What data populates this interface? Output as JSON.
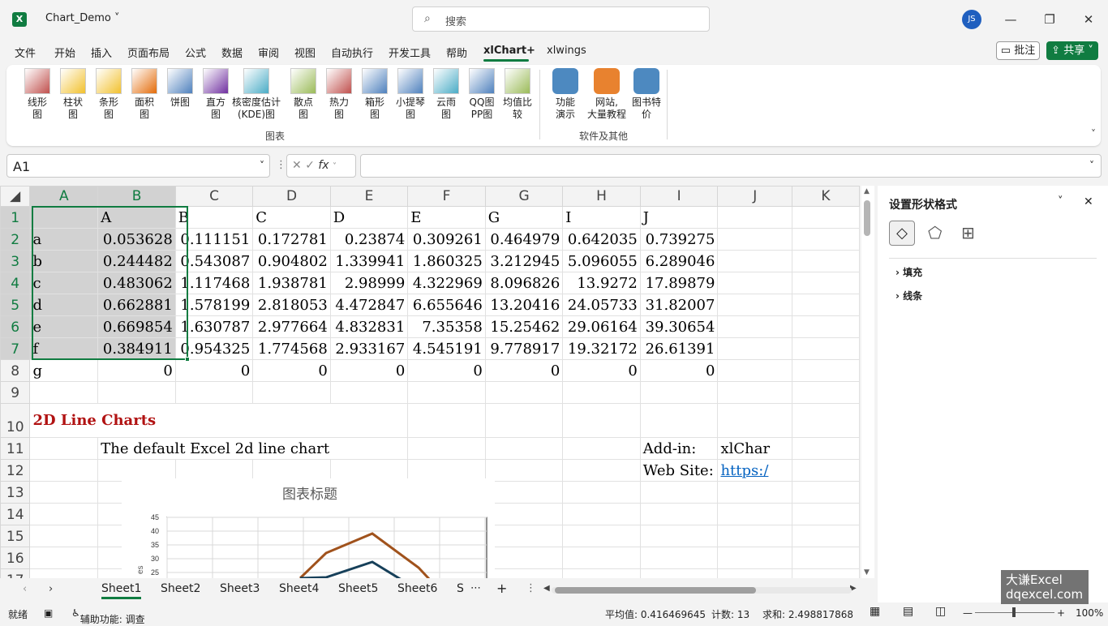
{
  "app": {
    "file_name": "Chart_Demo",
    "search_placeholder": "搜索",
    "user_initials": "JS"
  },
  "menu": {
    "tabs": [
      "文件",
      "开始",
      "插入",
      "页面布局",
      "公式",
      "数据",
      "审阅",
      "视图",
      "自动执行",
      "开发工具",
      "帮助",
      "xlChart+",
      "xlwings"
    ],
    "active_tab": "xlChart+",
    "comment": "批注",
    "share": "共享"
  },
  "ribbon": {
    "chart_buttons": [
      {
        "label": "线形\n图",
        "icon": "line-chart-icon"
      },
      {
        "label": "柱状\n图",
        "icon": "column-chart-icon"
      },
      {
        "label": "条形\n图",
        "icon": "bar-chart-icon"
      },
      {
        "label": "面积\n图",
        "icon": "area-chart-icon"
      },
      {
        "label": "饼图",
        "icon": "pie-chart-icon"
      },
      {
        "label": "直方\n图",
        "icon": "histogram-icon"
      },
      {
        "label": "核密度估计\n(KDE)图",
        "icon": "kde-chart-icon"
      },
      {
        "label": "散点\n图",
        "icon": "scatter-chart-icon"
      },
      {
        "label": "热力\n图",
        "icon": "heatmap-icon"
      },
      {
        "label": "箱形\n图",
        "icon": "box-plot-icon"
      },
      {
        "label": "小提琴\n图",
        "icon": "violin-plot-icon"
      },
      {
        "label": "云雨\n图",
        "icon": "raincloud-plot-icon"
      },
      {
        "label": "QQ图\nPP图",
        "icon": "qq-plot-icon"
      },
      {
        "label": "均值比\n较",
        "icon": "mean-compare-icon"
      }
    ],
    "other_buttons": [
      {
        "label": "功能\n演示",
        "icon": "demo-icon"
      },
      {
        "label": "网站,\n大量教程",
        "icon": "website-icon"
      },
      {
        "label": "图书特\n价",
        "icon": "book-icon"
      }
    ],
    "group_charts": "图表",
    "group_other": "软件及其他"
  },
  "formula_bar": {
    "name_box": "A1",
    "value": ""
  },
  "sheet": {
    "columns": [
      "A",
      "B",
      "C",
      "D",
      "E",
      "F",
      "G",
      "H",
      "I",
      "J",
      "K"
    ],
    "rows": [
      [
        "",
        "A",
        "B",
        "C",
        "D",
        "E",
        "G",
        "I",
        "J",
        "",
        ""
      ],
      [
        "a",
        "0.053628",
        "0.111151",
        "0.172781",
        "0.23874",
        "0.309261",
        "0.464979",
        "0.642035",
        "0.739275",
        "",
        ""
      ],
      [
        "b",
        "0.244482",
        "0.543087",
        "0.904802",
        "1.339941",
        "1.860325",
        "3.212945",
        "5.096055",
        "6.289046",
        "",
        ""
      ],
      [
        "c",
        "0.483062",
        "1.117468",
        "1.938781",
        "2.98999",
        "4.322969",
        "8.096826",
        "13.9272",
        "17.89879",
        "",
        ""
      ],
      [
        "d",
        "0.662881",
        "1.578199",
        "2.818053",
        "4.472847",
        "6.655646",
        "13.20416",
        "24.05733",
        "31.82007",
        "",
        ""
      ],
      [
        "e",
        "0.669854",
        "1.630787",
        "2.977664",
        "4.832831",
        "7.35358",
        "15.25462",
        "29.06164",
        "39.30654",
        "",
        ""
      ],
      [
        "f",
        "0.384911",
        "0.954325",
        "1.774568",
        "2.933167",
        "4.545191",
        "9.778917",
        "19.32172",
        "26.61391",
        "",
        ""
      ],
      [
        "g",
        "0",
        "0",
        "0",
        "0",
        "0",
        "0",
        "0",
        "0",
        "",
        ""
      ]
    ],
    "section_title": "2D Line Charts",
    "subtitle": "The default Excel 2d line chart",
    "addin_label": "Add-in:",
    "addin_value": "xlChar",
    "website_label": "Web Site:",
    "website_value": "https:/"
  },
  "chart": {
    "title": "图表标题",
    "y_ticks": [
      "45",
      "40",
      "35",
      "30",
      "25"
    ],
    "y_axis_partial": "es",
    "colors": {
      "series_brown": "#a0521c",
      "series_teal": "#17405a"
    }
  },
  "sheets": {
    "tabs": [
      "Sheet1",
      "Sheet2",
      "Sheet3",
      "Sheet4",
      "Sheet5",
      "Sheet6",
      "S"
    ],
    "active": "Sheet1"
  },
  "status": {
    "ready": "就绪",
    "accessibility": "辅助功能: 调查",
    "average": "平均值: 0.416469645",
    "count": "计数: 13",
    "sum": "求和: 2.498817868",
    "zoom": "100%"
  },
  "panel": {
    "title": "设置形状格式",
    "fill": "填充",
    "line": "线条"
  },
  "watermark": {
    "line1": "大谦Excel",
    "line2": "dqexcel.com"
  }
}
